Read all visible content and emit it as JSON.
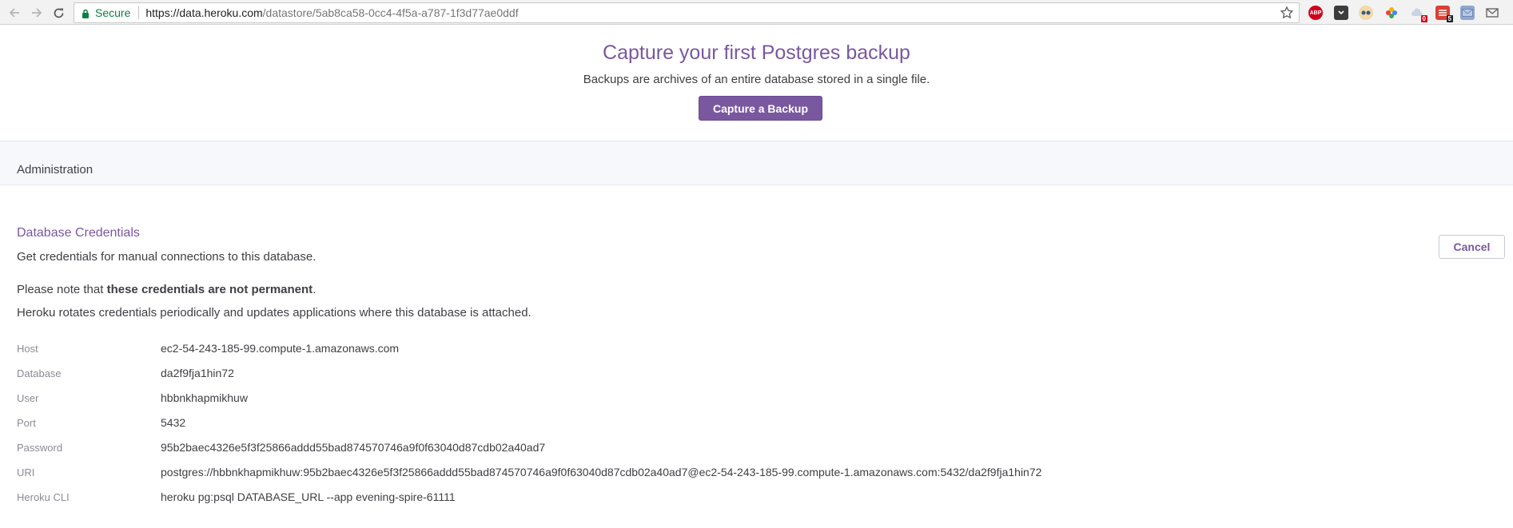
{
  "browser": {
    "secure_label": "Secure",
    "url_host": "https://data.heroku.com",
    "url_path": "/datastore/5ab8ca58-0cc4-4f5a-a787-1f3d77ae0ddf",
    "extensions": [
      {
        "name": "adblock-plus",
        "label": "ABP",
        "color": "#d0021b"
      },
      {
        "name": "pocket",
        "label": "",
        "color": "#3c3c3c"
      },
      {
        "name": "privacy-badger",
        "label": "",
        "color": "#e8a33b"
      },
      {
        "name": "photos",
        "label": "",
        "color": "#f5b400"
      },
      {
        "name": "weather",
        "label": "",
        "color": "#9db3d1",
        "badge": "0",
        "badge_color": "#d0021b"
      },
      {
        "name": "todoist",
        "label": "",
        "color": "#db4035",
        "badge": "5",
        "badge_color": "#222222"
      },
      {
        "name": "mail",
        "label": "",
        "color": "#8ea7cf"
      },
      {
        "name": "gmail",
        "label": "",
        "color": "#666666"
      }
    ]
  },
  "backup": {
    "title": "Capture your first Postgres backup",
    "subtitle": "Backups are archives of an entire database stored in a single file.",
    "button_label": "Capture a Backup"
  },
  "administration": {
    "title": "Administration"
  },
  "credentials": {
    "title": "Database Credentials",
    "subtitle": "Get credentials for manual connections to this database.",
    "note_prefix": "Please note that ",
    "note_bold": "these credentials are not permanent",
    "note_suffix": ".",
    "rotation": "Heroku rotates credentials periodically and updates applications where this database is attached.",
    "cancel_label": "Cancel",
    "rows": [
      {
        "label": "Host",
        "value": "ec2-54-243-185-99.compute-1.amazonaws.com"
      },
      {
        "label": "Database",
        "value": "da2f9fja1hin72"
      },
      {
        "label": "User",
        "value": "hbbnkhapmikhuw"
      },
      {
        "label": "Port",
        "value": "5432"
      },
      {
        "label": "Password",
        "value": "95b2baec4326e5f3f25866addd55bad874570746a9f0f63040d87cdb02a40ad7"
      },
      {
        "label": "URI",
        "value": "postgres://hbbnkhapmikhuw:95b2baec4326e5f3f25866addd55bad874570746a9f0f63040d87cdb02a40ad7@ec2-54-243-185-99.compute-1.amazonaws.com:5432/da2f9fja1hin72"
      },
      {
        "label": "Heroku CLI",
        "value": "heroku pg:psql DATABASE_URL --app evening-spire-61111"
      }
    ]
  },
  "colors": {
    "heroku_purple": "#79589f",
    "secure_green": "#0b8043"
  }
}
